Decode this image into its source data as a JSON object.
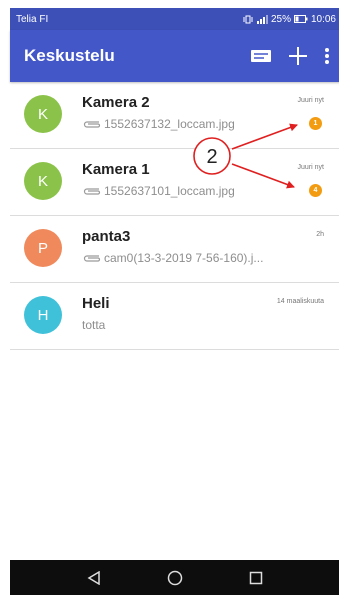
{
  "status_bar": {
    "carrier": "Telia FI",
    "battery_percent": "25%",
    "time": "10:06"
  },
  "app_bar": {
    "title": "Keskustelu",
    "icons": [
      "message-icon",
      "add-icon",
      "more-vert-icon"
    ]
  },
  "conversations": [
    {
      "initial": "K",
      "avatar_color": "#8bc34a",
      "name": "Kamera 2",
      "preview": "1552637132_loccam.jpg",
      "has_attachment": true,
      "time": "Juuri nyt",
      "unread": "1"
    },
    {
      "initial": "K",
      "avatar_color": "#8bc34a",
      "name": "Kamera 1",
      "preview": "1552637101_loccam.jpg",
      "has_attachment": true,
      "time": "Juuri nyt",
      "unread": "4"
    },
    {
      "initial": "P",
      "avatar_color": "#f08a5d",
      "name": "panta3",
      "preview": "cam0(13-3-2019 7-56-160).j...",
      "has_attachment": true,
      "time": "2h",
      "unread": ""
    },
    {
      "initial": "H",
      "avatar_color": "#3fc1d9",
      "name": "Heli",
      "preview": "totta",
      "has_attachment": false,
      "time": "14 maaliskuuta",
      "unread": ""
    }
  ],
  "annotation": {
    "label": "2",
    "color": "#e02020"
  },
  "nav_bar": {
    "icons": [
      "back-icon",
      "home-icon",
      "recents-icon"
    ]
  },
  "colors": {
    "primary": "#4457c9",
    "status_bar": "#3d50b8",
    "badge": "#f39c12"
  }
}
